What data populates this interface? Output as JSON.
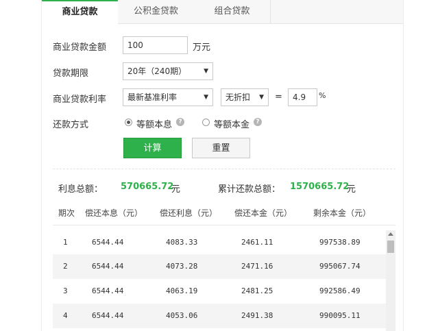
{
  "tabs": [
    "商业贷款",
    "公积金贷款",
    "组合贷款"
  ],
  "form": {
    "amount_label": "商业贷款金额",
    "amount_value": "100",
    "amount_unit": "万元",
    "term_label": "贷款期限",
    "term_value": "20年（240期）",
    "rate_label": "商业贷款利率",
    "rate_type": "最新基准利率",
    "discount": "无折扣",
    "equals": "=",
    "rate_value": "4.9",
    "percent": "%",
    "repay_label": "还款方式",
    "repay_option1": "等额本息",
    "repay_option2": "等额本金",
    "help_glyph": "?",
    "calc_button": "计算",
    "reset_button": "重置"
  },
  "summary": {
    "interest_label": "利息总额：",
    "interest_value": "570665.72",
    "interest_unit": "元",
    "total_label": "累计还款总额：",
    "total_value": "1570665.72",
    "total_unit": "元"
  },
  "table": {
    "headers": [
      "期次",
      "偿还本息（元）",
      "偿还利息（元）",
      "偿还本金（元）",
      "剩余本金（元）"
    ],
    "rows": [
      [
        "1",
        "6544.44",
        "4083.33",
        "2461.11",
        "997538.89"
      ],
      [
        "2",
        "6544.44",
        "4073.28",
        "2471.16",
        "995067.74"
      ],
      [
        "3",
        "6544.44",
        "4063.19",
        "2481.25",
        "992586.49"
      ],
      [
        "4",
        "6544.44",
        "4053.06",
        "2491.38",
        "990095.11"
      ]
    ]
  },
  "colors": {
    "accent": "#2eb14a"
  },
  "icons": {
    "help": "help-circle-icon",
    "dropdown": "chevron-down-icon",
    "scroll_up": "scroll-up-arrow-icon"
  }
}
